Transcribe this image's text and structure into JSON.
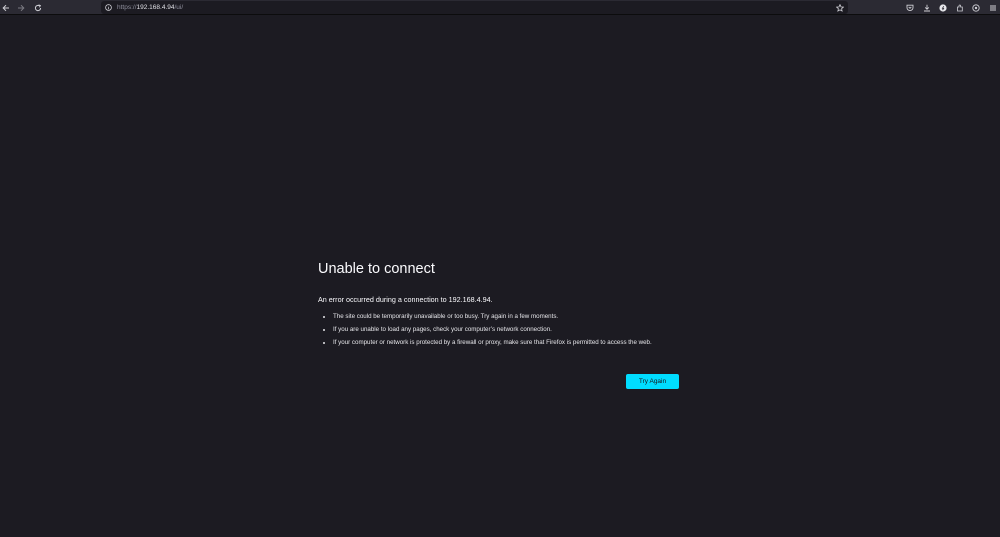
{
  "browser": {
    "url_prefix": "https://",
    "url_host": "192.168.4.94",
    "url_suffix": "/ui/",
    "icons": {
      "back": "back-arrow-icon",
      "forward": "forward-arrow-icon",
      "reload": "reload-icon",
      "site_info": "info-icon",
      "bookmark": "star-icon",
      "pocket": "pocket-icon",
      "downloads": "download-icon",
      "account": "account-icon",
      "extensions": "extensions-icon",
      "extension": "extension-icon",
      "menu": "hamburger-menu-icon"
    }
  },
  "error": {
    "title": "Unable to connect",
    "description": "An error occurred during a connection to 192.168.4.94.",
    "items": [
      "The site could be temporarily unavailable or too busy. Try again in a few moments.",
      "If you are unable to load any pages, check your computer’s network connection.",
      "If your computer or network is protected by a firewall or proxy, make sure that Firefox is permitted to access the web."
    ],
    "try_again_label": "Try Again"
  },
  "colors": {
    "page_background": "#1c1b22",
    "toolbar_background": "#2b2a33",
    "button_accent": "#00ddff"
  }
}
